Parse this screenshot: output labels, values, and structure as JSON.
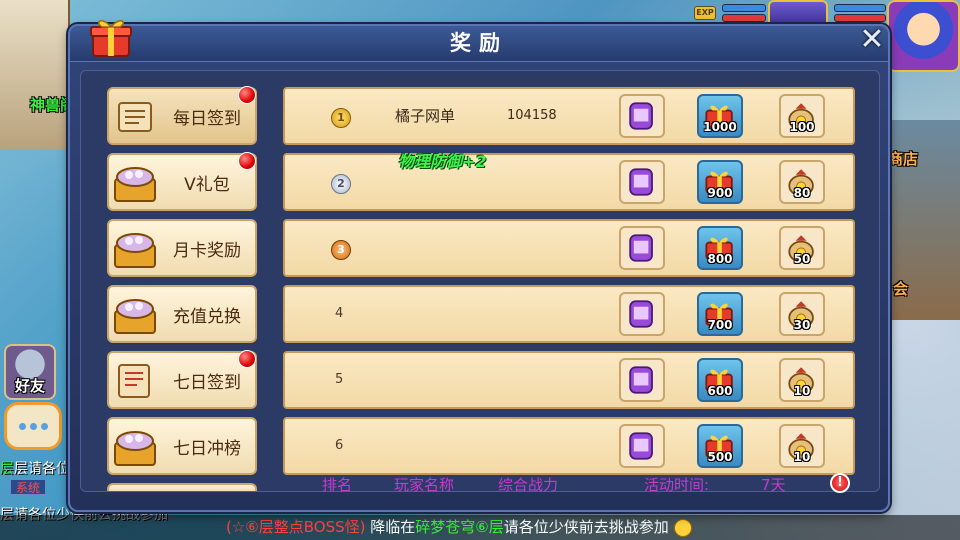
{
  "dialog": {
    "title": "奖励"
  },
  "tabs": [
    {
      "label": "每日签到",
      "badge": true
    },
    {
      "label": "V礼包",
      "badge": true
    },
    {
      "label": "月卡奖励",
      "badge": false
    },
    {
      "label": "充值兑换",
      "badge": false
    },
    {
      "label": "七日签到",
      "badge": true
    },
    {
      "label": "七日冲榜",
      "badge": false
    }
  ],
  "rows": [
    {
      "rank": "1",
      "name": "橘子网单",
      "power": "104158",
      "gift_count": "1000",
      "bag_count": "100"
    },
    {
      "rank": "2",
      "name": "",
      "power": "",
      "gift_count": "900",
      "bag_count": "80"
    },
    {
      "rank": "3",
      "name": "",
      "power": "",
      "gift_count": "800",
      "bag_count": "50"
    },
    {
      "rank": "4",
      "name": "",
      "power": "",
      "gift_count": "700",
      "bag_count": "30"
    },
    {
      "rank": "5",
      "name": "",
      "power": "",
      "gift_count": "600",
      "bag_count": "10"
    },
    {
      "rank": "6",
      "name": "",
      "power": "",
      "gift_count": "500",
      "bag_count": "10"
    }
  ],
  "buff_popup": "物理防御+2",
  "footer": {
    "rank_header": "排名",
    "name_header": "玩家名称",
    "power_header": "综合战力",
    "time_label": "活动时间:",
    "time_value": "7天"
  },
  "hud": {
    "exp_label": "EXP",
    "friend_label": "好友",
    "shop_label": "商店",
    "guild_fragment": "会",
    "shrine_label": "神兽阁",
    "system_tag": "系统"
  },
  "chat": {
    "line1": "层请各位",
    "line2": "层请各位少侠前去挑战参加",
    "marquee_part1": "(☆⑥层整点BOSS怪)",
    "marquee_part2": "降临在",
    "marquee_part3": "碎梦苍穹⑥层",
    "marquee_part4": "请各位少侠前去挑战参加"
  },
  "colors": {
    "dialog_bg": "#2b3b66",
    "row_bg": "#f6e0b3",
    "footer_text": "#c43bd0",
    "buff_text": "#3df54a",
    "badge_red": "#e00000"
  }
}
